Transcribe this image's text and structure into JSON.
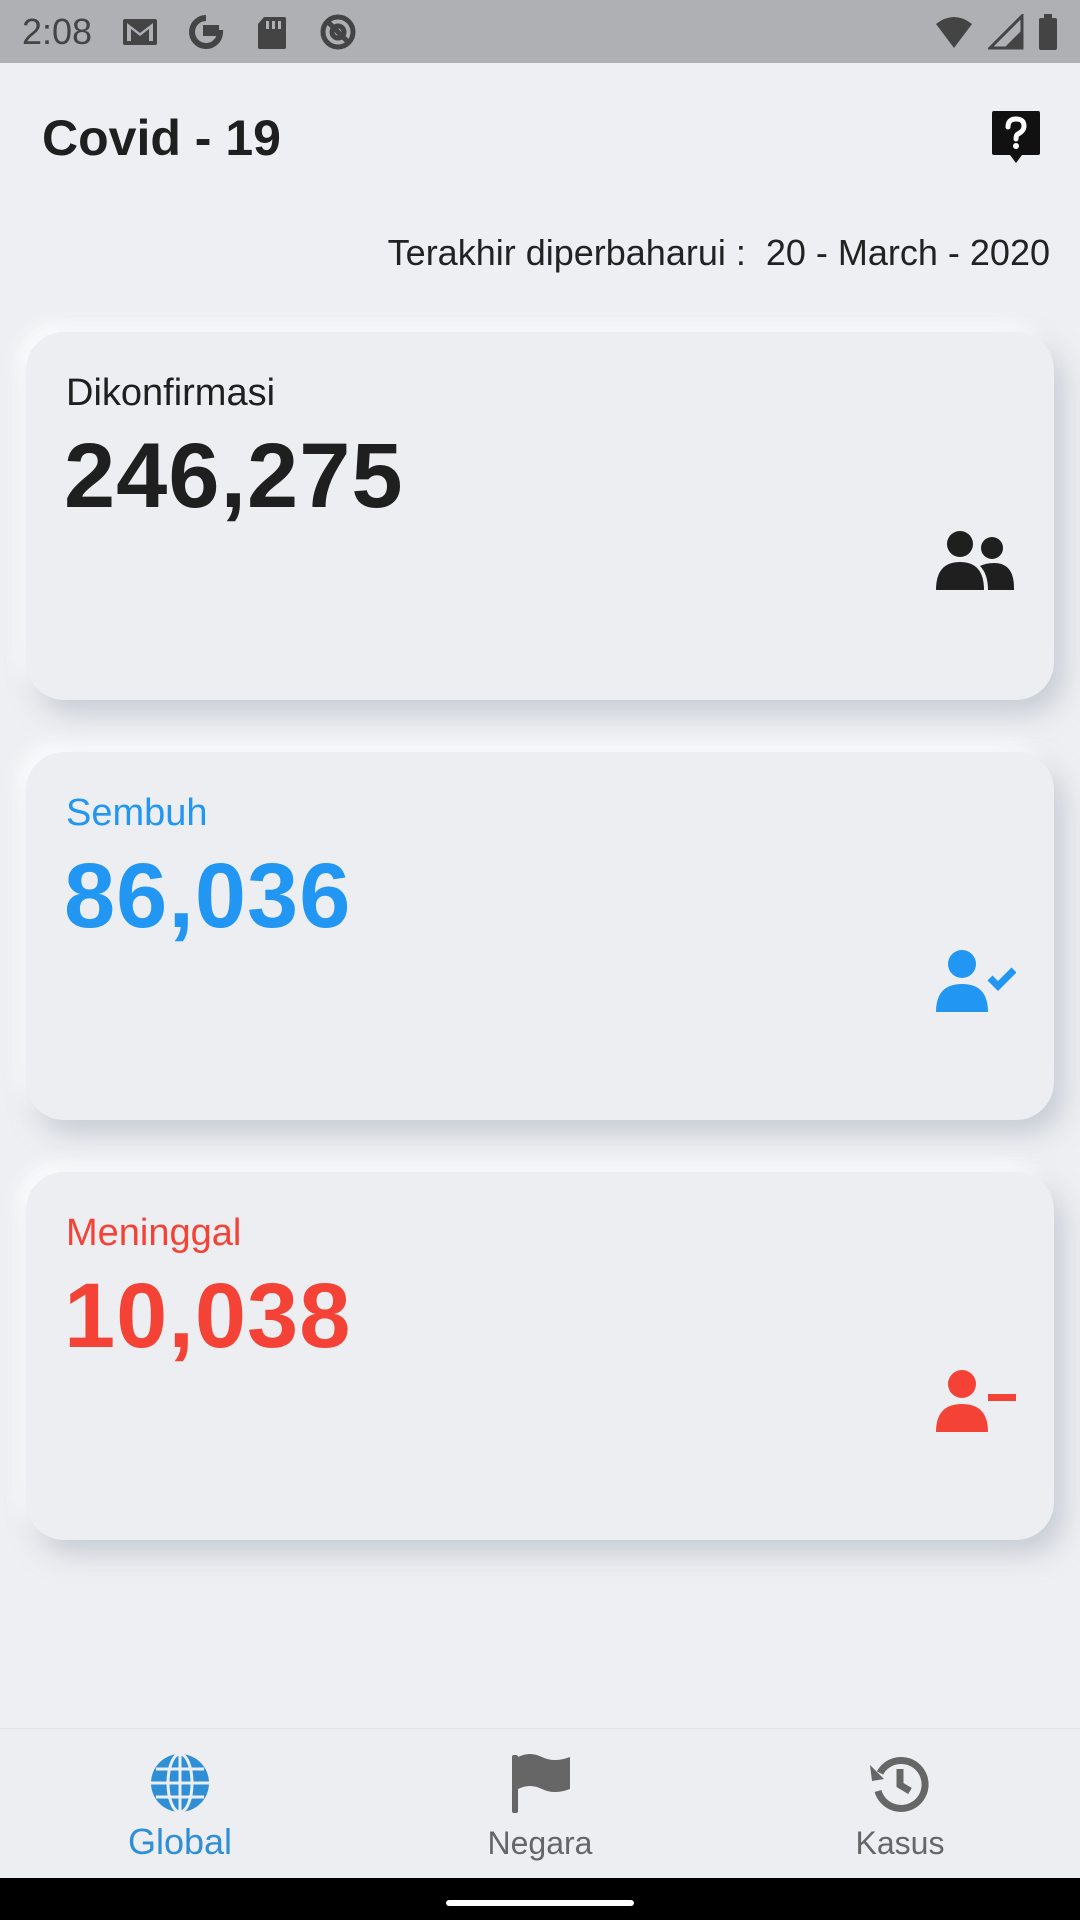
{
  "status_bar": {
    "time": "2:08",
    "left_icons": [
      "gmail-icon",
      "google-icon",
      "sd-card-icon",
      "at-sign-icon"
    ],
    "right_icons": [
      "wifi-icon",
      "cell-signal-icon",
      "battery-icon"
    ]
  },
  "header": {
    "title": "Covid - 19",
    "help_icon": "help-bubble-icon"
  },
  "last_updated": "Terakhir diperbaharui :  20 - March - 2020",
  "cards": [
    {
      "label": "Dikonfirmasi",
      "value": "246,275",
      "color": "#1f1f1f",
      "icon": "users-icon"
    },
    {
      "label": "Sembuh",
      "value": "86,036",
      "color": "#2196f3",
      "icon": "user-check-icon"
    },
    {
      "label": "Meninggal",
      "value": "10,038",
      "color": "#f44336",
      "icon": "user-minus-icon"
    }
  ],
  "bottom_nav": [
    {
      "label": "Global",
      "icon": "globe-icon",
      "active": true
    },
    {
      "label": "Negara",
      "icon": "flag-icon",
      "active": false
    },
    {
      "label": "Kasus",
      "icon": "history-icon",
      "active": false
    }
  ],
  "colors": {
    "accent": "#2f8fd6",
    "recovered": "#2196f3",
    "deaths": "#f44336",
    "background": "#edeff2"
  }
}
